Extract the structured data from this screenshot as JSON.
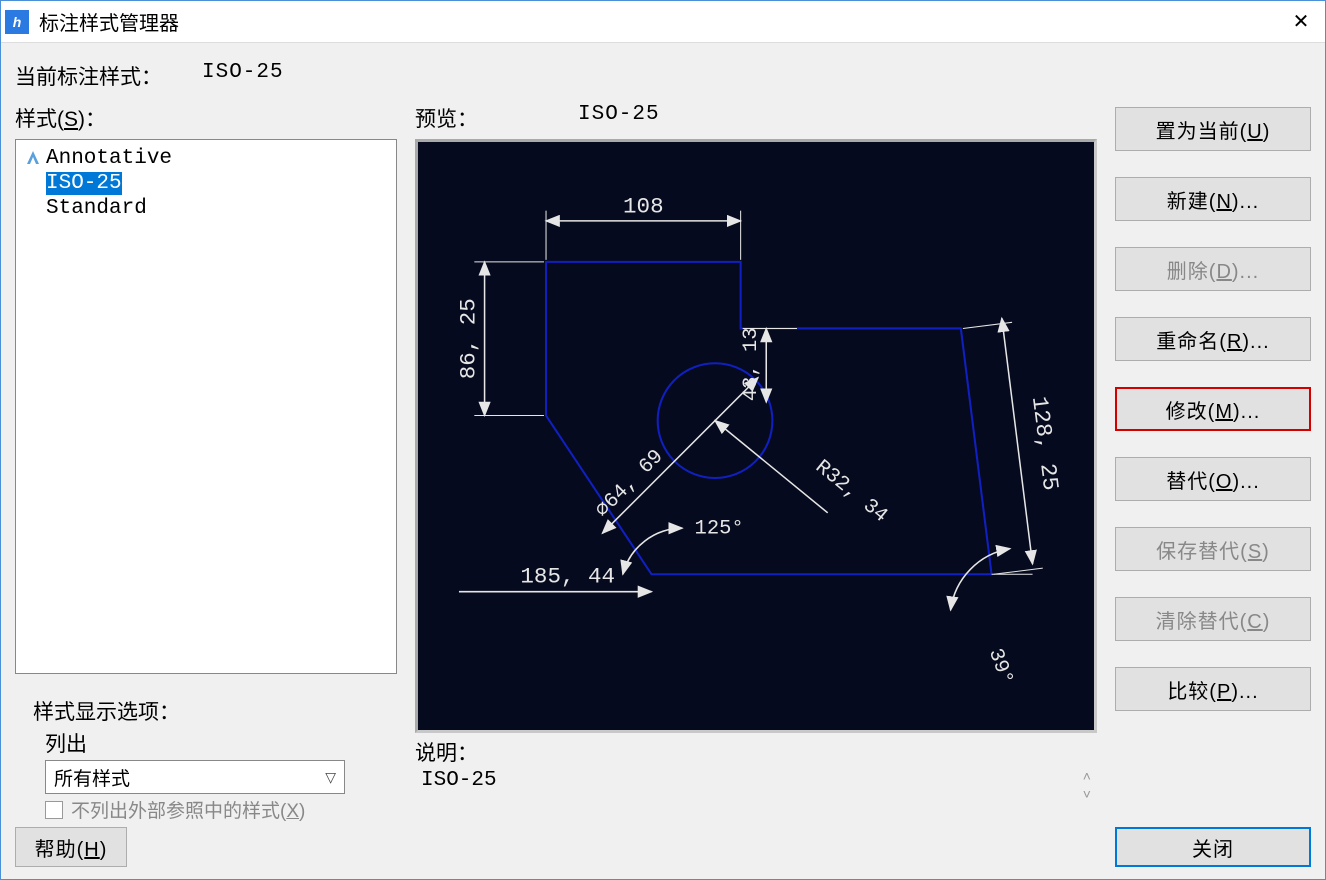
{
  "window": {
    "title": "标注样式管理器"
  },
  "header": {
    "current_label": "当前标注样式：",
    "current_value": "ISO-25",
    "styles_label": "样式(S)：",
    "preview_label": "预览：",
    "preview_value": "ISO-25"
  },
  "styles": {
    "items": [
      {
        "name": "Annotative",
        "annotative": true,
        "selected": false
      },
      {
        "name": "ISO-25",
        "annotative": false,
        "selected": true
      },
      {
        "name": "Standard",
        "annotative": false,
        "selected": false
      }
    ]
  },
  "display_options": {
    "title": "样式显示选项：",
    "list_label": "列出",
    "filter_selected": "所有样式",
    "exclude_xref_label": "不列出外部参照中的样式(X)",
    "exclude_xref_checked": false,
    "exclude_xref_enabled": false
  },
  "preview": {
    "dims": {
      "d108": "108",
      "d86_25": "86, 25",
      "d43_13": "43, 13",
      "d128_25": "128, 25",
      "r32_34": "R32, 34",
      "d64_69": "∅64, 69",
      "a125": "125°",
      "d185_44": "185, 44",
      "a39": "39°"
    }
  },
  "description": {
    "label": "说明：",
    "text": "ISO-25"
  },
  "buttons": {
    "set_current": "置为当前(U)",
    "new": "新建(N)...",
    "delete": "删除(D)...",
    "rename": "重命名(R)...",
    "modify": "修改(M)...",
    "override": "替代(O)...",
    "save_override": "保存替代(S)",
    "clear_override": "清除替代(C)",
    "compare": "比较(P)...",
    "help": "帮助(H)",
    "close": "关闭"
  }
}
